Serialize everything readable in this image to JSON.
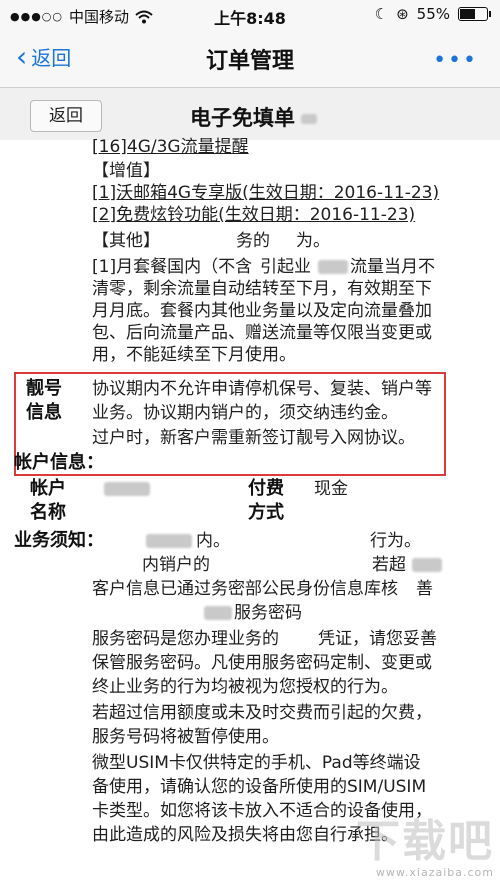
{
  "status_bar": {
    "carrier": "中国移动",
    "time": "上午8:48",
    "battery": "55%",
    "battery_level": 0.55
  },
  "nav": {
    "back_label": "返回",
    "title": "订单管理",
    "more_label": "•••"
  },
  "doc_header": {
    "back_label": "返回",
    "title": "电子免填单"
  },
  "content": {
    "l0": "[16]4G/3G流量提醒",
    "l1": "【增值】",
    "l2": "[1]沃邮箱4G专享版(生效日期：2016-11-23)",
    "l3": "[2]免费炫铃功能(生效日期：2016-11-23)",
    "l4": "【其他】",
    "l4b": "务的",
    "l4c": "为。",
    "l5a": "[1]月套餐国内（不含",
    "l5b": "引起业",
    "l5c": "流量当月不",
    "l6": "清零，剩余流量自动结转至下月，有效期至下",
    "l7": "月月底。套餐内其他业务量以及定向流量叠加",
    "l8": "包、后向流量产品、赠送流量等仅限当变更或",
    "l9": "用，不能延续至下月使用。",
    "beauty_label_1": "靓号",
    "beauty_label_2": "信息",
    "b1": "协议期内不允许申请停机保号、复装、销户等",
    "b2": "业务。协议期内销户的，须交纳违约金。",
    "b3": "过户时，新客户需重新签订靓号入网协议。",
    "account_info_label": "帐户信息：",
    "account_label": "帐户",
    "payment_label_1": "付费",
    "payment_value": "现金",
    "name_label": "名称",
    "payment_label_2": "方式",
    "notice_label": "业务须知：",
    "n1a": "内。",
    "n1b": "行为。",
    "n2a": "内销户的",
    "n2b": "若超",
    "n3": "客户信息已通过务密部公民身份信息库核",
    "n3b": "善",
    "n4": "服务密码",
    "s1": "服务密码是您办理业务的",
    "s1b": "凭证，请您妥善",
    "s2": "保管服务密码。凡使用服务密码定制、变更或",
    "s3": "终止业务的行为均被视为您授权的行为。",
    "s4": "若超过信用额度或未及时交费而引起的欠费，",
    "s5": "服务号码将被暂停使用。",
    "s6": "微型USIM卡仅供特定的手机、Pad等终端设",
    "s7": "备使用，请确认您的设备所使用的SIM/USIM",
    "s8": "卡类型。如您将该卡放入不适合的设备使用，",
    "s9": "由此造成的风险及损失将由您自行承担。"
  },
  "watermark": {
    "logo_text": "下载吧",
    "url": "www.xiazaiba.com"
  },
  "colors": {
    "ios_blue": "#1a74d9",
    "highlight_red": "#d93a3a"
  }
}
